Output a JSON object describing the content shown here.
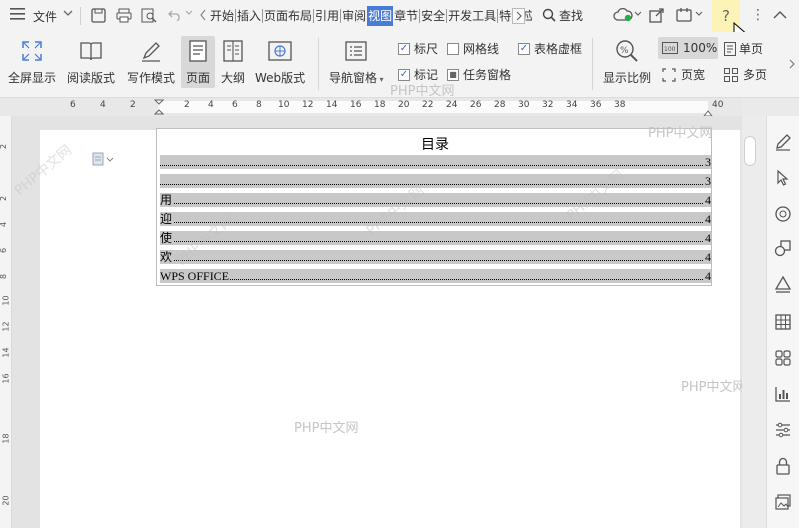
{
  "titlebar": {
    "menu_label": "文件",
    "tabs": [
      {
        "label": "开始",
        "active": false
      },
      {
        "label": "插入",
        "active": false
      },
      {
        "label": "页面布局",
        "active": false
      },
      {
        "label": "引用",
        "active": false
      },
      {
        "label": "审阅",
        "active": false
      },
      {
        "label": "视图",
        "active": true
      },
      {
        "label": "章节",
        "active": false
      },
      {
        "label": "安全",
        "active": false
      },
      {
        "label": "开发工具",
        "active": false
      },
      {
        "label": "特色应",
        "active": false
      }
    ],
    "search_label": "查找",
    "help_glyph": "?",
    "more_glyph": "⋮"
  },
  "ribbon": {
    "buttons": {
      "fullscreen": "全屏显示",
      "reading": "阅读版式",
      "writing": "写作模式",
      "page": "页面",
      "outline": "大纲",
      "web": "Web版式",
      "nav_pane": "导航窗格",
      "zoom": "显示比例",
      "zoom_value": "100%",
      "single_page": "单页",
      "page_width": "页宽",
      "multi_page": "多页"
    },
    "checkboxes": {
      "ruler": {
        "label": "标尺",
        "checked": true
      },
      "gridlines": {
        "label": "网格线",
        "checked": false
      },
      "table_gridlines": {
        "label": "表格虚框",
        "checked": true
      },
      "marks": {
        "label": "标记",
        "checked": true
      },
      "task_pane": {
        "label": "任务窗格",
        "checked": true
      }
    }
  },
  "ruler": {
    "h_labels": [
      "6",
      "4",
      "2",
      "2",
      "4",
      "6",
      "8",
      "10",
      "12",
      "14",
      "16",
      "18",
      "20",
      "22",
      "24",
      "26",
      "28",
      "30",
      "32",
      "34",
      "36",
      "38",
      "40"
    ],
    "v_labels": [
      "2",
      "2",
      "4",
      "6",
      "8",
      "10",
      "12",
      "14",
      "16",
      "18",
      "20"
    ]
  },
  "toc": {
    "title": "目录",
    "entries": [
      {
        "text": "",
        "page": "3"
      },
      {
        "text": "",
        "page": "3"
      },
      {
        "text": "用",
        "page": "4"
      },
      {
        "text": "迎",
        "page": "4"
      },
      {
        "text": "使",
        "page": "4"
      },
      {
        "text": "欢",
        "page": "4"
      },
      {
        "text": "WPS OFFICE",
        "page": "4"
      }
    ]
  },
  "watermark": "PHP中文网",
  "colors": {
    "active_tab": "#4a7bd6",
    "accent_check": "#2f6bd2",
    "toc_highlight": "#c8c8c8"
  }
}
